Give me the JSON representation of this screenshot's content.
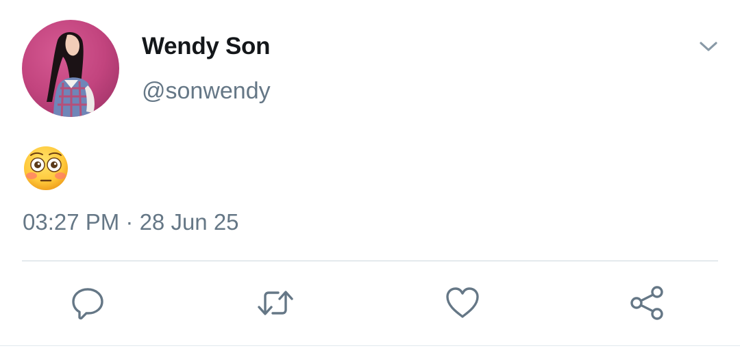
{
  "tweet": {
    "display_name": "Wendy Son",
    "handle": "@sonwendy",
    "text_emoji": "flushed-face",
    "timestamp": "03:27 PM · 28 Jun 25"
  },
  "icons": {
    "menu": "chevron-down-icon",
    "reply": "speech-bubble-icon",
    "retweet": "retweet-icon",
    "like": "heart-icon",
    "share": "share-icon"
  },
  "colors": {
    "name": "#14171a",
    "secondary": "#657786",
    "divider": "#ccd6dd",
    "avatar_bg": "#c2447e"
  }
}
